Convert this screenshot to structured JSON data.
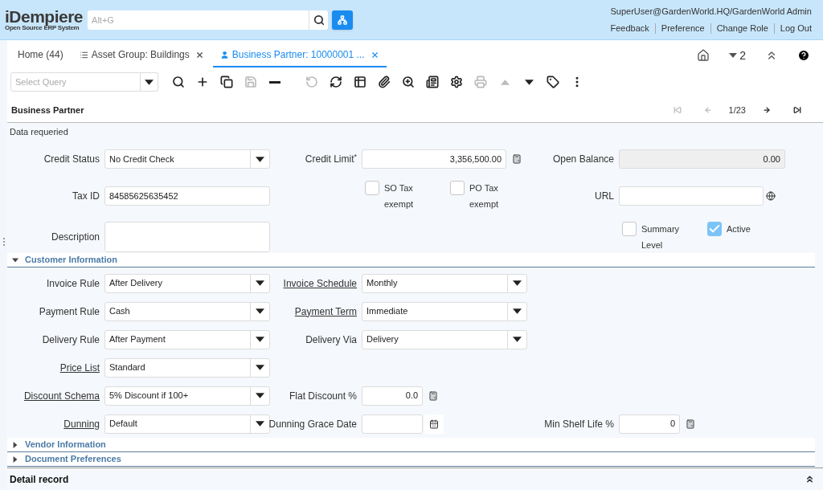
{
  "header": {
    "logo": {
      "title": "iDempiere",
      "subtitle": "Open Source ERP System"
    },
    "search": {
      "placeholder": "Alt+G"
    },
    "user": "SuperUser@GardenWorld.HQ/GardenWorld Admin",
    "links": [
      "Feedback",
      "Preference",
      "Change Role",
      "Log Out"
    ]
  },
  "tabs": [
    {
      "label": "Home (44)",
      "selected": false,
      "kind": "home"
    },
    {
      "label": "Asset Group: Buildings",
      "selected": false,
      "kind": "list"
    },
    {
      "label": "Business Partner: 10000001 ...",
      "selected": true,
      "kind": "person"
    }
  ],
  "tab_actions": {
    "window_count": "2"
  },
  "toolbar": {
    "query": {
      "placeholder": "Select Query"
    },
    "buttons": [
      {
        "kind": "search",
        "disabled": false
      },
      {
        "kind": "new",
        "disabled": false
      },
      {
        "kind": "copy",
        "disabled": false
      },
      {
        "kind": "save",
        "disabled": true
      },
      {
        "kind": "delete",
        "disabled": false
      },
      {
        "kind": "undo",
        "disabled": true
      },
      {
        "kind": "refresh",
        "disabled": false
      },
      {
        "kind": "grid",
        "disabled": false
      },
      {
        "kind": "attach",
        "disabled": false
      },
      {
        "kind": "zoom",
        "disabled": false
      },
      {
        "kind": "report",
        "disabled": false
      },
      {
        "kind": "settings",
        "disabled": false
      },
      {
        "kind": "print",
        "disabled": true
      },
      {
        "kind": "up",
        "disabled": true
      },
      {
        "kind": "down",
        "disabled": false
      },
      {
        "kind": "tag",
        "disabled": false
      },
      {
        "kind": "more",
        "disabled": false
      }
    ]
  },
  "panel": {
    "title": "Business Partner",
    "record": "1/23",
    "nav": [
      {
        "kind": "first",
        "disabled": true
      },
      {
        "kind": "previous",
        "disabled": true
      },
      {
        "kind": "next",
        "disabled": false
      },
      {
        "kind": "last",
        "disabled": false
      }
    ]
  },
  "status": "Data requeried",
  "rows": [
    {
      "left": {
        "kind": "select",
        "label": "Credit Status",
        "value": "No Credit Check"
      },
      "middle": {
        "kind": "number",
        "label": "Credit Limit$^{*}$",
        "value": "3,356,500.00"
      },
      "right": {
        "kind": "readonly",
        "label": "Open Balance",
        "value": "0.00"
      }
    },
    {
      "left": {
        "kind": "text",
        "label": "Tax ID",
        "value": "84585625635452"
      },
      "middle": {
        "kind": "checkboxes",
        "items": [
          {
            "label": "SO Tax exempt",
            "checked": false
          },
          {
            "label": "PO Tax exempt",
            "checked": false
          }
        ]
      },
      "right": {
        "kind": "url",
        "label": "URL"
      }
    },
    {
      "left": {
        "kind": "textarea",
        "label": "Description"
      },
      "right": {
        "kind": "checkboxes",
        "items": [
          {
            "label": "Summary Level",
            "checked": false
          },
          {
            "label": "Active",
            "checked": true
          }
        ]
      }
    }
  ],
  "sections": [
    {
      "title": "Customer Information",
      "expanded": true,
      "rows": [
        {
          "left": {
            "kind": "select",
            "label": "Invoice Rule",
            "value": "After Delivery",
            "link": false
          },
          "middle": {
            "kind": "select",
            "label": "Invoice Schedule",
            "value": "Monthly",
            "link": true
          }
        },
        {
          "left": {
            "kind": "select",
            "label": "Payment Rule",
            "value": "Cash",
            "link": false
          },
          "middle": {
            "kind": "select",
            "label": "Payment Term",
            "value": "Immediate",
            "link": true
          }
        },
        {
          "left": {
            "kind": "select",
            "label": "Delivery Rule",
            "value": "After Payment",
            "link": false
          },
          "middle": {
            "kind": "select",
            "label": "Delivery Via",
            "value": "Delivery",
            "link": false
          }
        },
        {
          "left": {
            "kind": "select",
            "label": "Price List",
            "value": "Standard",
            "link": true
          }
        },
        {
          "left": {
            "kind": "select",
            "label": "Discount Schema",
            "value": "5% Discount if 100+",
            "link": true
          },
          "middle": {
            "kind": "short_number",
            "label": "Flat Discount %",
            "value": "0.0",
            "link": false
          }
        },
        {
          "left": {
            "kind": "select",
            "label": "Dunning",
            "value": "Default",
            "link": true
          },
          "middle": {
            "kind": "date",
            "label": "Dunning Grace Date",
            "link": false
          },
          "right": {
            "kind": "short_number",
            "label": "Min Shelf Life %",
            "value": "0",
            "link": false
          }
        }
      ]
    },
    {
      "title": "Vendor Information",
      "expanded": false
    },
    {
      "title": "Document Preferences",
      "expanded": false
    }
  ],
  "footer": {
    "title": "Detail record"
  }
}
